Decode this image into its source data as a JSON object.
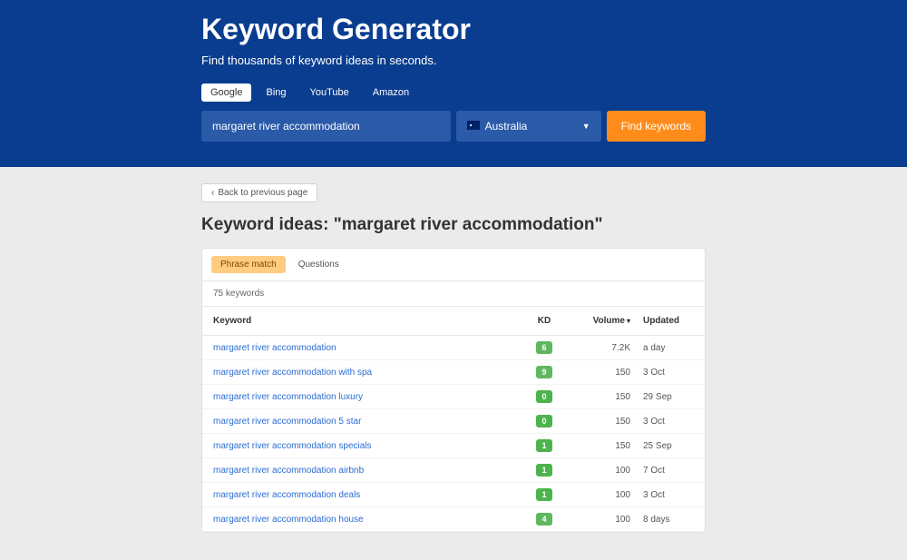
{
  "hero": {
    "title": "Keyword Generator",
    "subtitle": "Find thousands of keyword ideas in seconds.",
    "engines": [
      "Google",
      "Bing",
      "YouTube",
      "Amazon"
    ],
    "active_engine": 0,
    "search_value": "margaret river accommodation",
    "country": "Australia",
    "find_label": "Find keywords"
  },
  "content": {
    "back_label": "Back to previous page",
    "page_title": "Keyword ideas: \"margaret river accommodation\"",
    "tabs": [
      "Phrase match",
      "Questions"
    ],
    "active_tab": 0,
    "count_text": "75 keywords",
    "headers": {
      "keyword": "Keyword",
      "kd": "KD",
      "volume": "Volume",
      "updated": "Updated"
    },
    "rows": [
      {
        "keyword": "margaret river accommodation",
        "kd": 6,
        "kd_color": "#5fb85f",
        "volume": "7.2K",
        "updated": "a day"
      },
      {
        "keyword": "margaret river accommodation with spa",
        "kd": 9,
        "kd_color": "#5fb85f",
        "volume": "150",
        "updated": "3 Oct"
      },
      {
        "keyword": "margaret river accommodation luxury",
        "kd": 0,
        "kd_color": "#4db34d",
        "volume": "150",
        "updated": "29 Sep"
      },
      {
        "keyword": "margaret river accommodation 5 star",
        "kd": 0,
        "kd_color": "#4db34d",
        "volume": "150",
        "updated": "3 Oct"
      },
      {
        "keyword": "margaret river accommodation specials",
        "kd": 1,
        "kd_color": "#4db34d",
        "volume": "150",
        "updated": "25 Sep"
      },
      {
        "keyword": "margaret river accommodation airbnb",
        "kd": 1,
        "kd_color": "#4db34d",
        "volume": "100",
        "updated": "7 Oct"
      },
      {
        "keyword": "margaret river accommodation deals",
        "kd": 1,
        "kd_color": "#4db34d",
        "volume": "100",
        "updated": "3 Oct"
      },
      {
        "keyword": "margaret river accommodation house",
        "kd": 4,
        "kd_color": "#5fb85f",
        "volume": "100",
        "updated": "8 days"
      }
    ]
  }
}
